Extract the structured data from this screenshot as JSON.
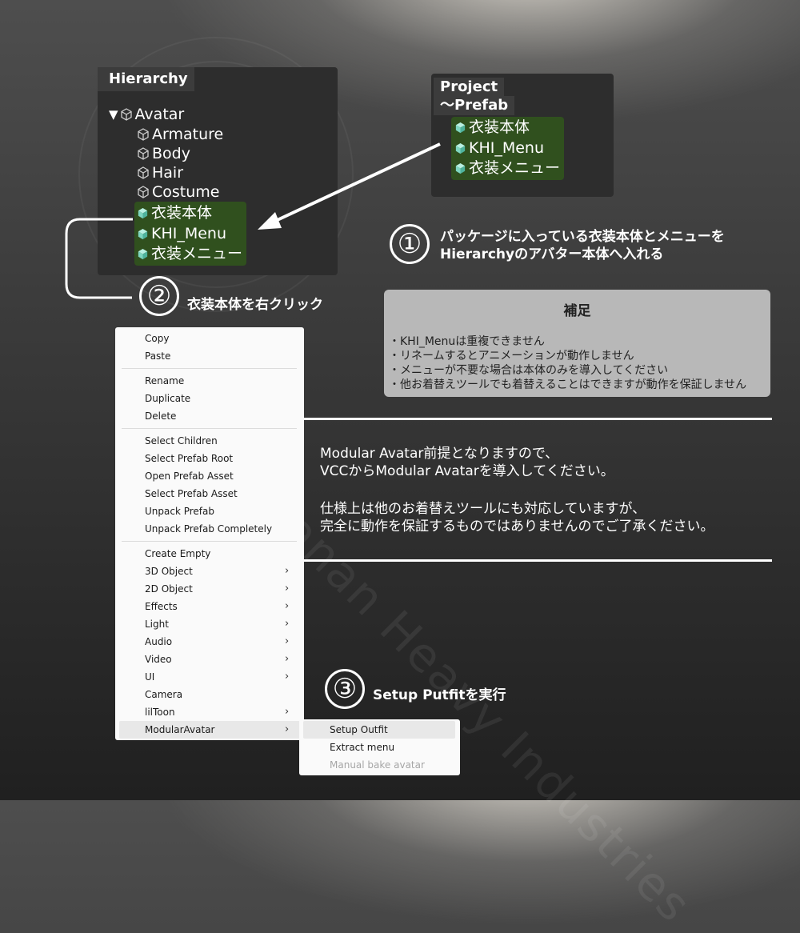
{
  "hierarchy": {
    "tab": "Hierarchy",
    "root": "Avatar",
    "children": [
      "Armature",
      "Body",
      "Hair",
      "Costume"
    ],
    "prefab_children": [
      "衣装本体",
      "KHI_Menu",
      "衣装メニュー"
    ]
  },
  "project": {
    "tab_line1": "Project",
    "tab_line2": "～Prefab",
    "items": [
      "衣装本体",
      "KHI_Menu",
      "衣装メニュー"
    ]
  },
  "steps": [
    {
      "num": "①",
      "lines": [
        "パッケージに入っている衣装本体とメニューを",
        "Hierarchyのアバター本体へ入れる"
      ]
    },
    {
      "num": "②",
      "lines": [
        "衣装本体を右クリック"
      ]
    },
    {
      "num": "③",
      "lines": [
        "Setup Putfitを実行"
      ]
    }
  ],
  "note": {
    "title": "補足",
    "lines": [
      "・KHI_Menuは重複できません",
      "・リネームするとアニメーションが動作しません",
      "・メニューが不要な場合は本体のみを導入してください",
      "・他お着替えツールでも着替えることはできますが動作を保証しません"
    ]
  },
  "info": {
    "lines": [
      "Modular Avatar前提となりますので、",
      "VCCからModular Avatarを導入してください。",
      "",
      "仕様上は他のお着替えツールにも対応していますが、",
      "完全に動作を保証するものではありませんのでご了承ください。"
    ]
  },
  "context_menu": {
    "items": [
      "Copy",
      "Paste",
      "Rename",
      "Duplicate",
      "Delete",
      "Select Children",
      "Select Prefab Root",
      "Open Prefab Asset",
      "Select Prefab Asset",
      "Unpack Prefab",
      "Unpack Prefab Completely",
      "Create Empty",
      "3D Object",
      "2D Object",
      "Effects",
      "Light",
      "Audio",
      "Video",
      "UI",
      "Camera",
      "lilToon",
      "ModularAvatar"
    ],
    "chevron": "›"
  },
  "submenu": {
    "items": [
      "Setup Outfit",
      "Extract menu",
      "Manual bake avatar"
    ]
  },
  "watermark": "Kanan Heavy Industries",
  "colors": {
    "panel": "#2d2d2d",
    "panel_tab": "#3c3c3c",
    "prefab_green": "#30501e",
    "prefab_icon": "#7fd6c0",
    "note_bg": "#b8b8b8",
    "menu_bg": "#fafafa"
  }
}
